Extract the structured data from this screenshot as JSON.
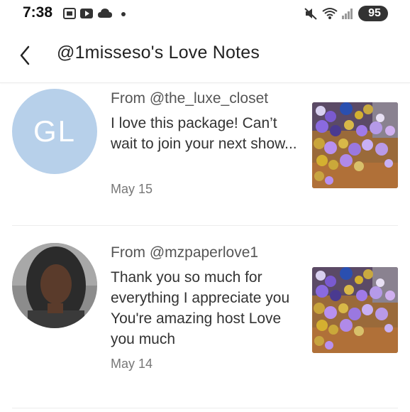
{
  "status_bar": {
    "time": "7:38",
    "battery": "95",
    "icons": [
      "screenshot-icon",
      "youtube-icon",
      "cloud-icon",
      "dot-icon",
      "mute-icon",
      "wifi-icon",
      "signal-icon",
      "battery-icon"
    ]
  },
  "header": {
    "title": "@1misseso's Love Notes",
    "back_icon": "chevron-left-icon"
  },
  "notes": [
    {
      "avatar_initials": "GL",
      "from": "From @the_luxe_closet",
      "message": "I love this package! Can’t wait to join your next show...",
      "date": "May 15"
    },
    {
      "from": "From @mzpaperlove1",
      "message": "Thank you so much for everything I appreciate you You're amazing host Love you much",
      "date": "May 14"
    }
  ],
  "colors": {
    "avatar_gl": "#b7d0ea",
    "text": "#333333",
    "muted": "#777777"
  }
}
